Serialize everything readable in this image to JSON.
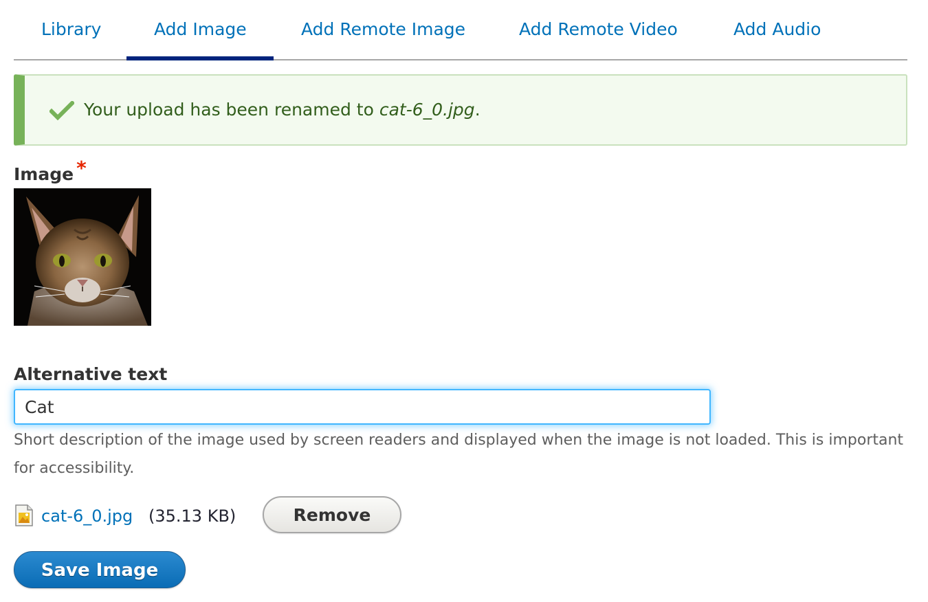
{
  "tabs": [
    {
      "label": "Library",
      "active": false
    },
    {
      "label": "Add Image",
      "active": true
    },
    {
      "label": "Add Remote Image",
      "active": false
    },
    {
      "label": "Add Remote Video",
      "active": false
    },
    {
      "label": "Add Audio",
      "active": false
    }
  ],
  "status": {
    "icon": "checkmark-icon",
    "text_prefix": "Your upload has been renamed to ",
    "filename": "cat-6_0.jpg",
    "text_suffix": ".",
    "color": "#325e1c"
  },
  "image_field": {
    "label": "Image",
    "required_marker": "*"
  },
  "alt_text": {
    "label": "Alternative text",
    "value": "Cat",
    "description": "Short description of the image used by screen readers and displayed when the image is not loaded. This is important for accessibility."
  },
  "file": {
    "icon": "image-file-icon",
    "name": "cat-6_0.jpg",
    "size": "(35.13 KB)",
    "remove_label": "Remove"
  },
  "actions": {
    "save_label": "Save Image"
  },
  "colors": {
    "link": "#0071b8",
    "active_tab_underline": "#00247d",
    "status_border": "#77b259",
    "required": "#e62600",
    "primary_button": "#0a6cb5"
  }
}
